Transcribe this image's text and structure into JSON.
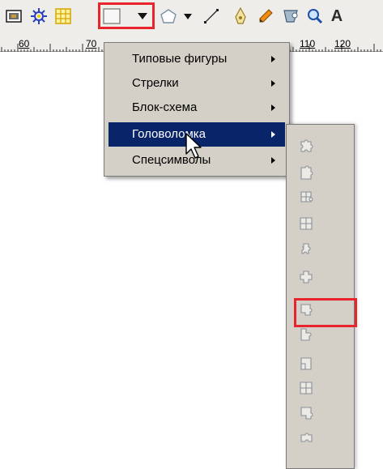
{
  "toolbar": {
    "buttons": [
      {
        "name": "image-icon"
      },
      {
        "name": "gear-icon"
      },
      {
        "name": "table-icon"
      },
      {
        "name": "basic-shapes-icon"
      },
      {
        "name": "dropdown-arrow-icon"
      },
      {
        "name": "polygon-icon"
      },
      {
        "name": "dropdown-arrow-icon"
      },
      {
        "name": "line-icon"
      },
      {
        "name": "bezier-pen-icon"
      },
      {
        "name": "pencil-icon"
      },
      {
        "name": "shape-edit-icon"
      },
      {
        "name": "zoom-icon"
      },
      {
        "name": "text-icon"
      }
    ],
    "text_button_label": "A"
  },
  "ruler": {
    "labels": [
      "60",
      "70",
      "110",
      "120"
    ]
  },
  "menu": {
    "items": [
      {
        "label": "Типовые фигуры",
        "active": false
      },
      {
        "label": "Стрелки",
        "active": false
      },
      {
        "label": "Блок-схема",
        "active": false
      },
      {
        "label": "Головоломка",
        "active": true
      },
      {
        "label": "Спецсимволы",
        "active": false
      }
    ]
  },
  "submenu": {
    "items": [
      {
        "name": "puzzle-piece-1-icon"
      },
      {
        "name": "puzzle-piece-2-icon"
      },
      {
        "name": "puzzle-piece-3-icon"
      },
      {
        "name": "puzzle-piece-4-icon"
      },
      {
        "name": "puzzle-piece-5-icon"
      },
      {
        "name": "puzzle-piece-6-icon"
      },
      {
        "name": "puzzle-piece-7-icon",
        "highlighted": true
      },
      {
        "name": "puzzle-piece-8-icon"
      },
      {
        "name": "puzzle-piece-9-icon"
      },
      {
        "name": "puzzle-piece-10-icon"
      },
      {
        "name": "puzzle-piece-11-icon"
      },
      {
        "name": "puzzle-piece-12-icon"
      }
    ]
  },
  "colors": {
    "highlight": "#e8242c",
    "menu_bg": "#d4d0c8",
    "menu_active": "#0a246a",
    "toolbar_bg": "#efedea"
  }
}
